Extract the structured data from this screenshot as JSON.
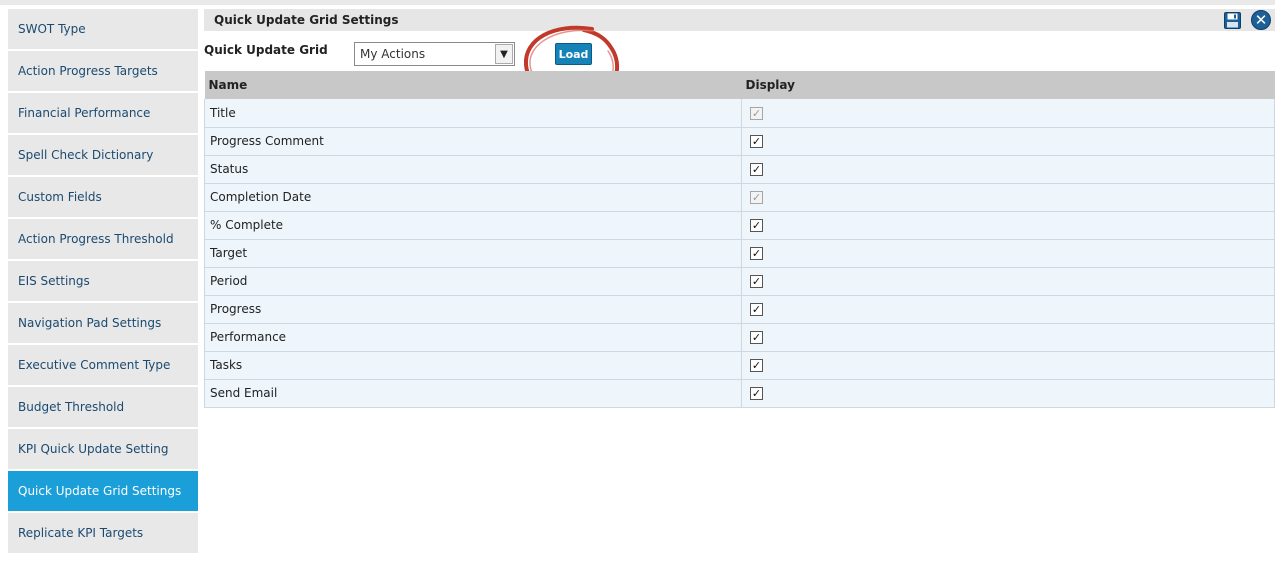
{
  "sidebar": {
    "items": [
      {
        "label": "SWOT Type",
        "active": false
      },
      {
        "label": "Action Progress Targets",
        "active": false
      },
      {
        "label": "Financial Performance",
        "active": false
      },
      {
        "label": "Spell Check Dictionary",
        "active": false
      },
      {
        "label": "Custom Fields",
        "active": false
      },
      {
        "label": "Action Progress Threshold",
        "active": false
      },
      {
        "label": "EIS Settings",
        "active": false
      },
      {
        "label": "Navigation Pad Settings",
        "active": false
      },
      {
        "label": "Executive Comment Type",
        "active": false
      },
      {
        "label": "Budget Threshold",
        "active": false
      },
      {
        "label": "KPI Quick Update Setting",
        "active": false
      },
      {
        "label": "Quick Update Grid Settings",
        "active": true
      },
      {
        "label": "Replicate KPI Targets",
        "active": false
      }
    ]
  },
  "panel": {
    "title": "Quick Update Grid Settings",
    "icons": [
      "save-icon",
      "close-icon"
    ]
  },
  "toolbar": {
    "grid_label": "Quick Update Grid",
    "selected_grid": "My Actions",
    "load_label": "Load"
  },
  "table": {
    "columns": [
      "Name",
      "Display"
    ],
    "rows": [
      {
        "name": "Title",
        "checked": true,
        "disabled": true
      },
      {
        "name": "Progress Comment",
        "checked": true,
        "disabled": false
      },
      {
        "name": "Status",
        "checked": true,
        "disabled": false
      },
      {
        "name": "Completion Date",
        "checked": true,
        "disabled": true
      },
      {
        "name": "% Complete",
        "checked": true,
        "disabled": false
      },
      {
        "name": "Target",
        "checked": true,
        "disabled": false
      },
      {
        "name": "Period",
        "checked": true,
        "disabled": false
      },
      {
        "name": "Progress",
        "checked": true,
        "disabled": false
      },
      {
        "name": "Performance",
        "checked": true,
        "disabled": false
      },
      {
        "name": "Tasks",
        "checked": true,
        "disabled": false
      },
      {
        "name": "Send Email",
        "checked": true,
        "disabled": false
      }
    ]
  },
  "colors": {
    "active_item": "#1a9fd9",
    "header_bg": "#e6e6e6",
    "annotation": "#c0392b"
  }
}
